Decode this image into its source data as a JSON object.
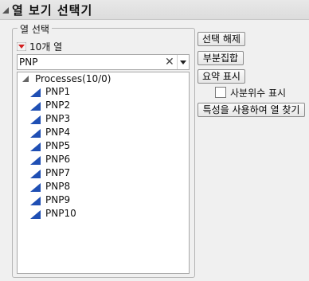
{
  "window": {
    "title": "열 보기 선택기"
  },
  "column_select": {
    "group_label": "열 선택",
    "count_label": "10개 열",
    "search": {
      "value": "PNP"
    },
    "tree": {
      "root_label": "Processes(10/0)",
      "items": [
        "PNP1",
        "PNP2",
        "PNP3",
        "PNP4",
        "PNP5",
        "PNP6",
        "PNP7",
        "PNP8",
        "PNP9",
        "PNP10"
      ]
    }
  },
  "actions": {
    "deselect_label": "선택 해제",
    "subset_label": "부분집합",
    "summary_label": "요약 표시",
    "quartile_label": "사분위수 표시",
    "find_by_property_label": "특성을 사용하여 열 찾기"
  },
  "icons": {
    "collapse": "triangle-down-icon",
    "red_menu": "red-triangle-menu-icon",
    "clear": "close-icon",
    "dropdown": "chevron-down-icon",
    "continuous": "continuous-column-icon"
  },
  "colors": {
    "red_menu": "#d22020",
    "continuous_icon": "#1f4fb4"
  }
}
